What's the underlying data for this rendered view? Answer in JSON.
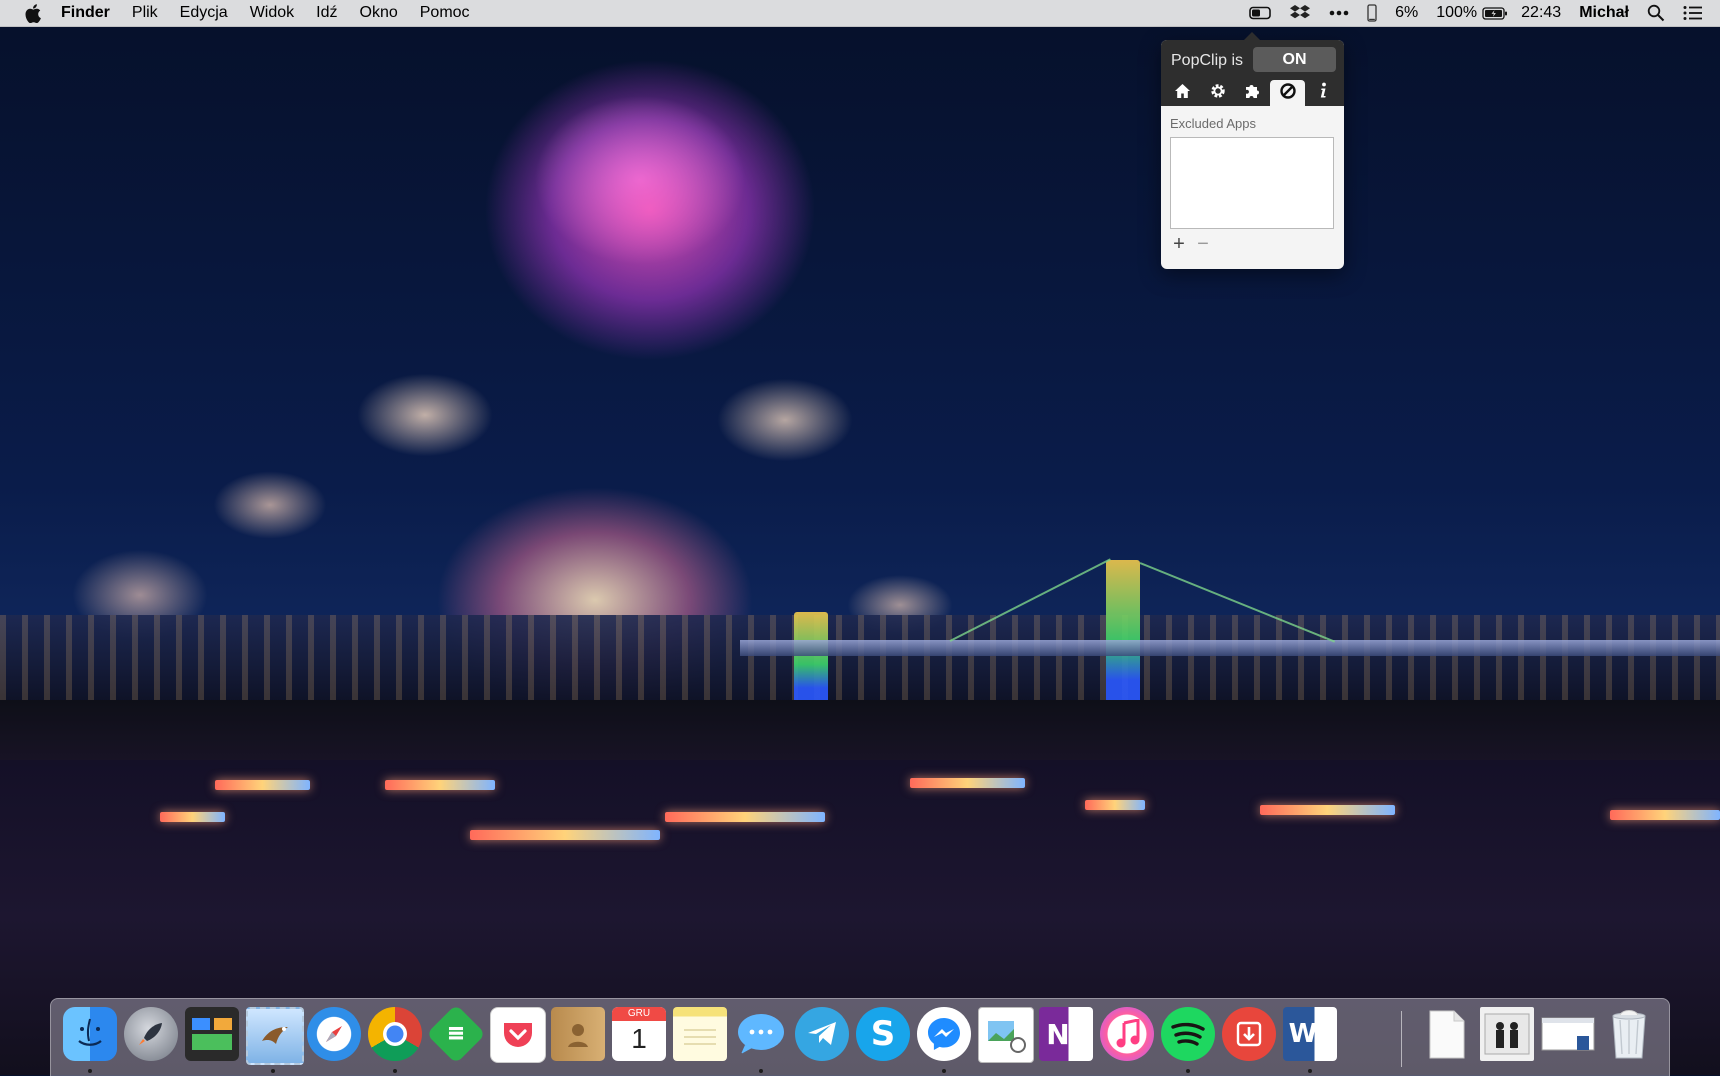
{
  "menubar": {
    "app_menu": "Finder",
    "menus": [
      "Plik",
      "Edycja",
      "Widok",
      "Idź",
      "Okno",
      "Pomoc"
    ],
    "status": {
      "battery_phone": "6%",
      "battery_main": "100%",
      "time": "22:43",
      "user": "Michał"
    },
    "icons": [
      "apple-icon",
      "popclip-menu-icon",
      "dropbox-icon",
      "more-icon",
      "phone-battery-icon",
      "battery-icon",
      "spotlight-icon",
      "notification-center-icon"
    ]
  },
  "popclip": {
    "title": "PopClip is",
    "toggle": "ON",
    "tabs": [
      "home-tab",
      "settings-tab",
      "extensions-tab",
      "excluded-apps-tab",
      "info-tab"
    ],
    "selected_tab": "excluded-apps-tab",
    "section_label": "Excluded Apps",
    "excluded_apps": [],
    "add_label": "+",
    "remove_label": "−"
  },
  "dock": {
    "apps": [
      {
        "name": "finder",
        "running": true
      },
      {
        "name": "launchpad",
        "running": false
      },
      {
        "name": "mission-control",
        "running": false
      },
      {
        "name": "mail",
        "running": true
      },
      {
        "name": "safari",
        "running": false
      },
      {
        "name": "chrome",
        "running": true
      },
      {
        "name": "feedly",
        "running": false
      },
      {
        "name": "pocket",
        "running": false
      },
      {
        "name": "contacts",
        "running": false
      },
      {
        "name": "calendar",
        "running": false,
        "month": "GRU",
        "day": "1"
      },
      {
        "name": "notes",
        "running": false
      },
      {
        "name": "messages",
        "running": true
      },
      {
        "name": "telegram",
        "running": false
      },
      {
        "name": "skype",
        "running": false
      },
      {
        "name": "messenger",
        "running": true
      },
      {
        "name": "preview",
        "running": false
      },
      {
        "name": "onenote",
        "running": false,
        "letter": "N"
      },
      {
        "name": "itunes",
        "running": false
      },
      {
        "name": "spotify",
        "running": true
      },
      {
        "name": "downloader",
        "running": false
      },
      {
        "name": "word",
        "running": true,
        "letter": "W"
      }
    ],
    "stacks": [
      "documents-stack",
      "downloads-stack",
      "window-stack",
      "trash"
    ]
  }
}
